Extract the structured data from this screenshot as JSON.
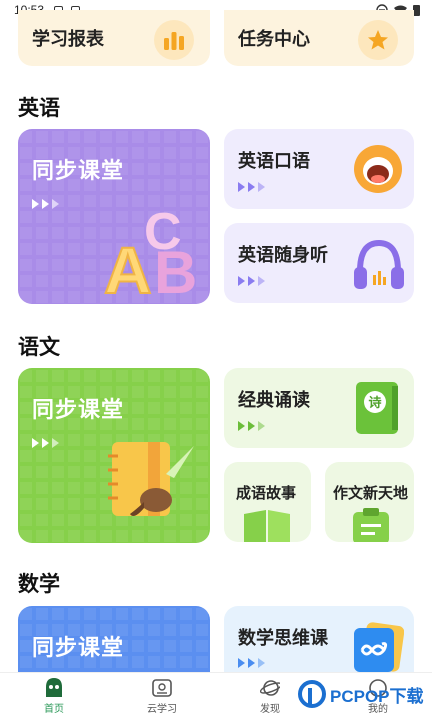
{
  "status_bar": {
    "time": "10:53"
  },
  "top_cards": {
    "study_report": "学习报表",
    "task_center": "任务中心"
  },
  "sections": {
    "english": {
      "title": "英语",
      "sync_class": "同步课堂",
      "oral": "英语口语",
      "listen": "英语随身听"
    },
    "chinese": {
      "title": "语文",
      "sync_class": "同步课堂",
      "classic": "经典诵读",
      "idiom": "成语故事",
      "composition": "作文新天地"
    },
    "math": {
      "title": "数学",
      "sync_class": "同步课堂",
      "thinking": "数学思维课"
    }
  },
  "tabs": [
    {
      "label": "首页",
      "icon": "home-icon",
      "active": true
    },
    {
      "label": "云学习",
      "icon": "cloud-study-icon",
      "active": false
    },
    {
      "label": "发现",
      "icon": "discover-icon",
      "active": false
    },
    {
      "label": "我的",
      "icon": "profile-icon",
      "active": false
    }
  ],
  "watermark": {
    "text": "PCPOP下载"
  },
  "colors": {
    "english_big": "#a98ce8",
    "chinese_big": "#86d04a",
    "math_big": "#5b8ff0",
    "english_small": "#efecfd",
    "chinese_small": "#eef8e3",
    "math_small": "#e6f2fd",
    "active_tab": "#2c9a5a"
  }
}
